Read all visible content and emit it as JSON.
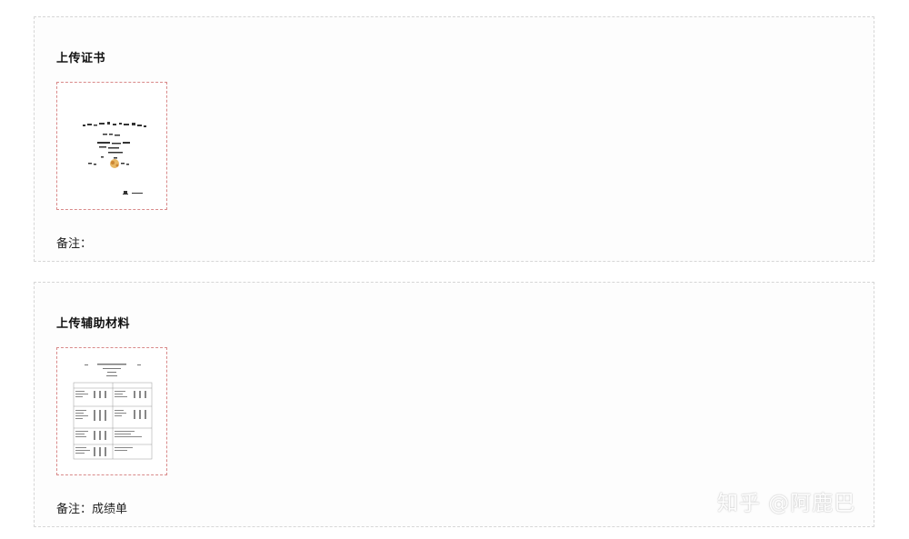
{
  "certificate_section": {
    "title": "上传证书",
    "note_label": "备注：",
    "note_value": ""
  },
  "aux_section": {
    "title": "上传辅助材料",
    "note_label": "备注：",
    "note_value": "成绩单"
  },
  "watermark": "知乎 @阿鹿巴",
  "colors": {
    "card_border": "#d6d6d6",
    "thumb_border": "#d98a8a",
    "seal": "#e0a030"
  }
}
